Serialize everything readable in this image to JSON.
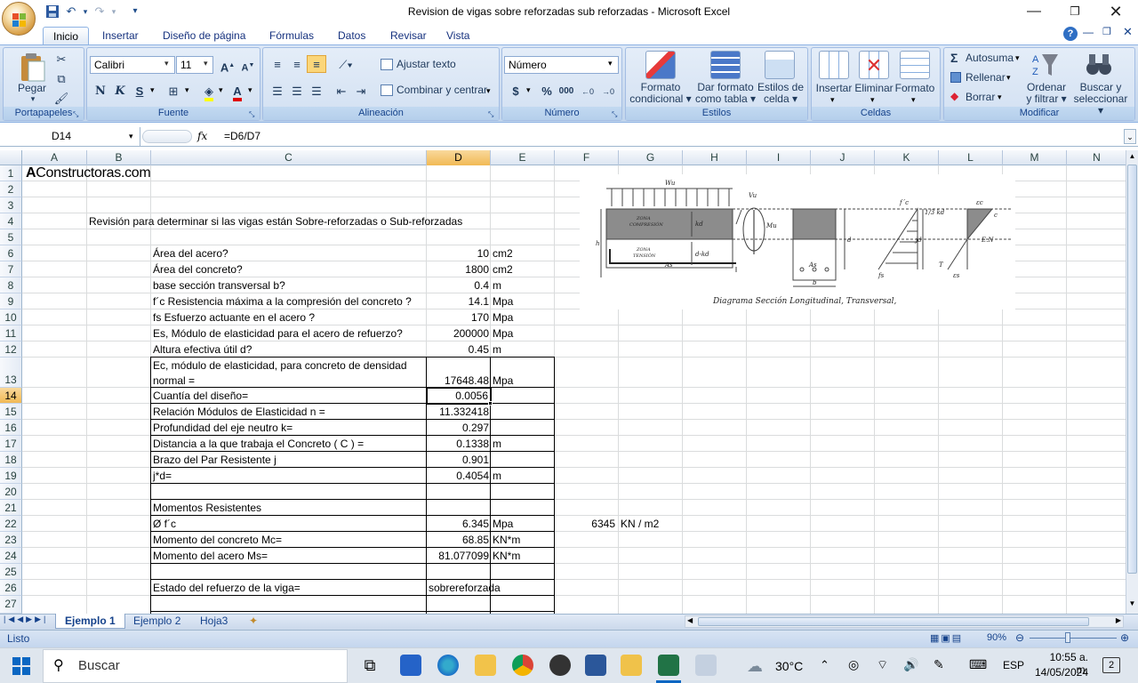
{
  "window": {
    "title": "Revision de vigas sobre reforzadas sub reforzadas - Microsoft Excel"
  },
  "tabs": [
    "Inicio",
    "Insertar",
    "Diseño de página",
    "Fórmulas",
    "Datos",
    "Revisar",
    "Vista"
  ],
  "ribbon": {
    "portapapeles": {
      "label": "Portapapeles",
      "paste": "Pegar"
    },
    "fuente": {
      "label": "Fuente",
      "font": "Calibri",
      "size": "11"
    },
    "alineacion": {
      "label": "Alineación",
      "wrap": "Ajustar texto",
      "merge": "Combinar y centrar"
    },
    "numero": {
      "label": "Número",
      "format": "Número"
    },
    "estilos": {
      "label": "Estilos",
      "cond1": "Formato",
      "cond2": "condicional",
      "tabla1": "Dar formato",
      "tabla2": "como tabla",
      "celda1": "Estilos de",
      "celda2": "celda"
    },
    "celdas": {
      "label": "Celdas",
      "insertar": "Insertar",
      "eliminar": "Eliminar",
      "formato": "Formato"
    },
    "modificar": {
      "label": "Modificar",
      "autosuma": "Autosuma",
      "rellenar": "Rellenar",
      "borrar": "Borrar",
      "ordenar1": "Ordenar",
      "ordenar2": "y filtrar",
      "buscar1": "Buscar y",
      "buscar2": "seleccionar"
    }
  },
  "formula_bar": {
    "name_box": "D14",
    "fx": "fx",
    "formula": "=D6/D7"
  },
  "columns": [
    "A",
    "B",
    "C",
    "D",
    "E",
    "F",
    "G",
    "H",
    "I",
    "J",
    "K",
    "L",
    "M",
    "N"
  ],
  "rows": [
    "1",
    "2",
    "3",
    "4",
    "5",
    "6",
    "7",
    "8",
    "9",
    "10",
    "11",
    "12",
    "13",
    "14",
    "15",
    "16",
    "17",
    "18",
    "19",
    "20",
    "21",
    "22",
    "23",
    "24",
    "25",
    "26",
    "27"
  ],
  "sheet": {
    "logo_a": "A",
    "logo_rest": "Constructoras.com",
    "heading": "Revisión para determinar si las vigas están Sobre-reforzadas o Sub-reforzadas",
    "inputs": [
      {
        "label": "Área del acero?",
        "value": "10",
        "unit": "cm2"
      },
      {
        "label": "Área del concreto?",
        "value": "1800",
        "unit": "cm2"
      },
      {
        "label": "base sección transversal b?",
        "value": "0.4",
        "unit": "m"
      },
      {
        "label": "f´c Resistencia máxima a la compresión del concreto ?",
        "value": "14.1",
        "unit": "Mpa"
      },
      {
        "label": "fs Esfuerzo actuante en el acero ?",
        "value": "170",
        "unit": "Mpa"
      },
      {
        "label": "Es, Módulo de elasticidad para el acero de refuerzo?",
        "value": "200000",
        "unit": "Mpa"
      },
      {
        "label": "Altura efectiva útil d?",
        "value": "0.45",
        "unit": "m"
      }
    ],
    "ec_label_1": "Ec, módulo de elasticidad, para concreto de densidad",
    "ec_label_2": "normal =",
    "ec_value": "17648.48",
    "ec_unit": "Mpa",
    "results": [
      {
        "label": "Cuantía del diseño=",
        "value": "0.0056",
        "unit": ""
      },
      {
        "label": "Relación Módulos de Elasticidad n =",
        "value": "11.332418",
        "unit": ""
      },
      {
        "label": "Profundidad del eje neutro k=",
        "value": "0.297",
        "unit": ""
      },
      {
        "label": "Distancia a la que trabaja el Concreto ( C )  =",
        "value": "0.1338",
        "unit": "m"
      },
      {
        "label": "Brazo del Par Resistente j",
        "value": "0.901",
        "unit": ""
      },
      {
        "label": "j*d=",
        "value": "0.4054",
        "unit": "m"
      }
    ],
    "momentos_title": "Momentos Resistentes",
    "moments": [
      {
        "label": "Ø f´c",
        "value": "6.345",
        "unit": "Mpa"
      },
      {
        "label": "Momento del concreto Mc=",
        "value": "68.85",
        "unit": "KN*m"
      },
      {
        "label": "Momento del acero Ms=",
        "value": "81.077099",
        "unit": "KN*m"
      }
    ],
    "f22_value": "6345",
    "g22_unit": "KN / m2",
    "estado_label": "Estado del refuerzo de la viga=",
    "estado_value": "sobrereforzada",
    "diagram": {
      "caption": "Diagrama Sección Longitudinal, Transversal,",
      "wu": "Wu",
      "vu": "Vu",
      "mu": "Mu",
      "zona_c1": "ZONA",
      "zona_c2": "COMPRESIÓN",
      "zona_t1": "ZONA",
      "zona_t2": "TENSIÓN",
      "kd": "kd",
      "dkd": "d-kd",
      "as": "As",
      "h": "h",
      "d": "d",
      "b": "b",
      "fc": "f´c",
      "kd3": "1/3 kd",
      "jd": "jd",
      "fs": "fs",
      "ec": "εc",
      "c": "c",
      "en": "E.N",
      "es": "εs",
      "t": "T"
    }
  },
  "sheet_tabs": [
    "Ejemplo 1",
    "Ejemplo 2",
    "Hoja3"
  ],
  "status": {
    "text": "Listo",
    "zoom": "90%"
  },
  "taskbar": {
    "search": "Buscar",
    "temp": "30°C",
    "lang": "ESP",
    "time": "10:55 a. m.",
    "date": "14/05/2024",
    "notif": "2"
  }
}
